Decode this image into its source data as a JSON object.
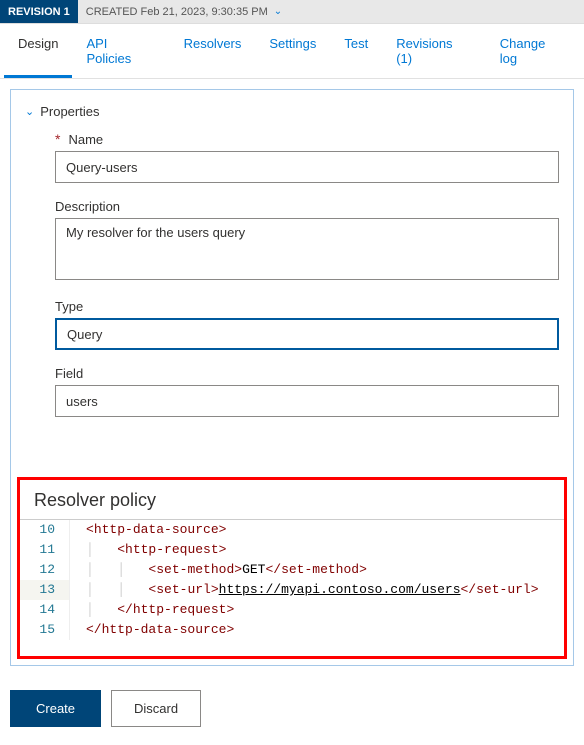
{
  "revision": {
    "badge": "REVISION 1",
    "created": "CREATED Feb 21, 2023, 9:30:35 PM"
  },
  "tabs": {
    "design": "Design",
    "api_policies": "API Policies",
    "resolvers": "Resolvers",
    "settings": "Settings",
    "test": "Test",
    "revisions": "Revisions (1)",
    "changelog": "Change log"
  },
  "properties": {
    "header": "Properties",
    "name_label": "Name",
    "name_value": "Query-users",
    "desc_label": "Description",
    "desc_value": "My resolver for the users query",
    "type_label": "Type",
    "type_value": "Query",
    "field_label": "Field",
    "field_value": "users"
  },
  "resolver": {
    "title": "Resolver policy",
    "lines": {
      "l10": "10",
      "l11": "11",
      "l12": "12",
      "l13": "13",
      "l14": "14",
      "l15": "15"
    },
    "code": {
      "http_data_source_open": "http-data-source",
      "http_request_open": "http-request",
      "set_method": "set-method",
      "method_val": "GET",
      "set_url": "set-url",
      "url_val": "https://myapi.contoso.com/users"
    }
  },
  "footer": {
    "create": "Create",
    "discard": "Discard"
  }
}
